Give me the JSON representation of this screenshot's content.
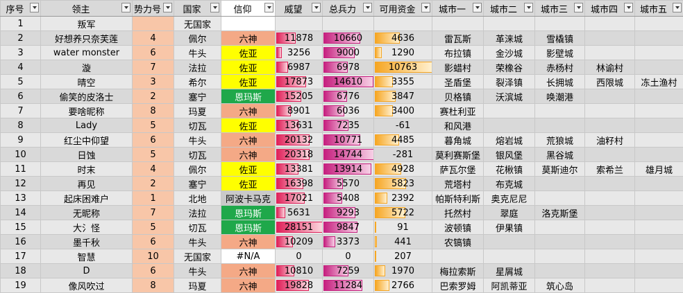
{
  "headers": {
    "seq": "序号",
    "lord": "领主",
    "faction": "势力号",
    "country": "国家",
    "belief": "信仰",
    "prestige": "威望",
    "troops": "总兵力",
    "funds": "可用资金",
    "city1": "城市一",
    "city2": "城市二",
    "city3": "城市三",
    "city4": "城市四",
    "city5": "城市五"
  },
  "bar_max": {
    "prestige": 28151,
    "troops": 14744,
    "funds": 10763
  },
  "colors": {
    "faction_bg": "#f8c6a8",
    "belief_六神": "#f4a986",
    "belief_佐亚": "#ffff00",
    "belief_恩玛斯": "#1fa84a",
    "belief_阿波卡马克": "#c9c9c9",
    "prestige_bar": "#e0215a",
    "troops_bar": "#c6207f",
    "funds_bar": "#f6a623"
  },
  "rows": [
    {
      "seq": "1",
      "lord": "叛军",
      "faction": "",
      "country": "无国家",
      "belief": "",
      "prestige": "",
      "troops": "",
      "funds": "",
      "c1": "",
      "c2": "",
      "c3": "",
      "c4": "",
      "c5": ""
    },
    {
      "seq": "2",
      "lord": "好想养只奈芙莲",
      "faction": "4",
      "country": "佩尔",
      "belief": "六神",
      "prestige": "11878",
      "troops": "10660",
      "funds": "4636",
      "c1": "雷瓦斯",
      "c2": "革涞城",
      "c3": "雪橇镇",
      "c4": "",
      "c5": ""
    },
    {
      "seq": "3",
      "lord": "water monster",
      "faction": "6",
      "country": "牛头",
      "belief": "佐亚",
      "prestige": "3256",
      "troops": "9000",
      "funds": "1290",
      "c1": "布拉镇",
      "c2": "金沙城",
      "c3": "影壁城",
      "c4": "",
      "c5": ""
    },
    {
      "seq": "4",
      "lord": "漩",
      "faction": "7",
      "country": "法拉",
      "belief": "佐亚",
      "prestige": "6987",
      "troops": "6978",
      "funds": "10763",
      "c1": "影蜡村",
      "c2": "荣橡谷",
      "c3": "赤杨村",
      "c4": "林谕村",
      "c5": ""
    },
    {
      "seq": "5",
      "lord": "晴空",
      "faction": "3",
      "country": "希尔",
      "belief": "佐亚",
      "prestige": "17873",
      "troops": "14610",
      "funds": "3355",
      "c1": "圣盾堡",
      "c2": "裂泽镇",
      "c3": "长拥城",
      "c4": "西限城",
      "c5": "冻土渔村"
    },
    {
      "seq": "6",
      "lord": "偷笑的皮洛士",
      "faction": "2",
      "country": "塞宁",
      "belief": "恩玛斯",
      "prestige": "15205",
      "troops": "6776",
      "funds": "3847",
      "c1": "贝格镇",
      "c2": "沃滨城",
      "c3": "唤潮港",
      "c4": "",
      "c5": ""
    },
    {
      "seq": "7",
      "lord": "要啥昵称",
      "faction": "8",
      "country": "玛夏",
      "belief": "六神",
      "prestige": "8901",
      "troops": "6036",
      "funds": "3400",
      "c1": "赛杜利亚",
      "c2": "",
      "c3": "",
      "c4": "",
      "c5": ""
    },
    {
      "seq": "8",
      "lord": "Lady",
      "faction": "5",
      "country": "切瓦",
      "belief": "佐亚",
      "prestige": "13631",
      "troops": "7235",
      "funds": "-61",
      "c1": "和风港",
      "c2": "",
      "c3": "",
      "c4": "",
      "c5": ""
    },
    {
      "seq": "9",
      "lord": "红尘中仰望",
      "faction": "6",
      "country": "牛头",
      "belief": "六神",
      "prestige": "20132",
      "troops": "10771",
      "funds": "4485",
      "c1": "暮角城",
      "c2": "熔岩城",
      "c3": "荒狼城",
      "c4": "油籽村",
      "c5": ""
    },
    {
      "seq": "10",
      "lord": "日蚀",
      "faction": "5",
      "country": "切瓦",
      "belief": "六神",
      "prestige": "20318",
      "troops": "14744",
      "funds": "-281",
      "c1": "莫利赛斯堡",
      "c2": "银风堡",
      "c3": "黑谷城",
      "c4": "",
      "c5": ""
    },
    {
      "seq": "11",
      "lord": "时末",
      "faction": "4",
      "country": "佩尔",
      "belief": "佐亚",
      "prestige": "13381",
      "troops": "13914",
      "funds": "4928",
      "c1": "萨瓦尔堡",
      "c2": "花楸镇",
      "c3": "莫斯迪尔",
      "c4": "索希兰",
      "c5": "雄月城"
    },
    {
      "seq": "12",
      "lord": "再见",
      "faction": "2",
      "country": "塞宁",
      "belief": "佐亚",
      "prestige": "16398",
      "troops": "5570",
      "funds": "5823",
      "c1": "荒塔村",
      "c2": "布克城",
      "c3": "",
      "c4": "",
      "c5": ""
    },
    {
      "seq": "13",
      "lord": "起床困难户",
      "faction": "1",
      "country": "北地",
      "belief": "阿波卡马克",
      "prestige": "17021",
      "troops": "5408",
      "funds": "2392",
      "c1": "帕斯特利斯",
      "c2": "奥克尼尼",
      "c3": "",
      "c4": "",
      "c5": ""
    },
    {
      "seq": "14",
      "lord": "无昵称",
      "faction": "7",
      "country": "法拉",
      "belief": "恩玛斯",
      "prestige": "5631",
      "troops": "9293",
      "funds": "5722",
      "c1": "托然村",
      "c2": "翠庭",
      "c3": "洛克斯堡",
      "c4": "",
      "c5": ""
    },
    {
      "seq": "15",
      "lord": "大氵怪",
      "faction": "5",
      "country": "切瓦",
      "belief": "恩玛斯",
      "prestige": "28151",
      "troops": "9847",
      "funds": "91",
      "c1": "波顿镇",
      "c2": "伊果镇",
      "c3": "",
      "c4": "",
      "c5": ""
    },
    {
      "seq": "16",
      "lord": "墨千秋",
      "faction": "6",
      "country": "牛头",
      "belief": "六神",
      "prestige": "10209",
      "troops": "3373",
      "funds": "441",
      "c1": "农镐镇",
      "c2": "",
      "c3": "",
      "c4": "",
      "c5": ""
    },
    {
      "seq": "17",
      "lord": "智慧",
      "faction": "10",
      "country": "无国家",
      "belief": "#N/A",
      "prestige": "0",
      "troops": "0",
      "funds": "207",
      "c1": "",
      "c2": "",
      "c3": "",
      "c4": "",
      "c5": ""
    },
    {
      "seq": "18",
      "lord": "D",
      "faction": "6",
      "country": "牛头",
      "belief": "六神",
      "prestige": "10810",
      "troops": "7259",
      "funds": "1970",
      "c1": "梅拉索斯",
      "c2": "星屑城",
      "c3": "",
      "c4": "",
      "c5": ""
    },
    {
      "seq": "19",
      "lord": "像风吹过",
      "faction": "8",
      "country": "玛夏",
      "belief": "六神",
      "prestige": "19828",
      "troops": "11284",
      "funds": "2766",
      "c1": "巴索罗姆",
      "c2": "阿凯蒂亚",
      "c3": "筑心岛",
      "c4": "",
      "c5": ""
    }
  ]
}
